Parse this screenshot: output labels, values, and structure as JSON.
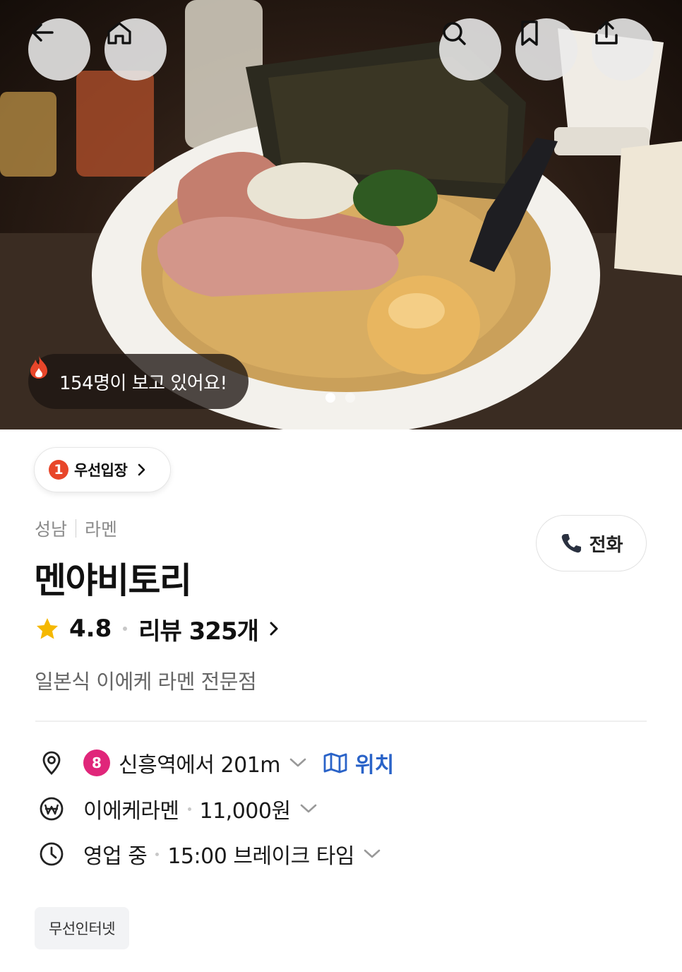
{
  "hero": {
    "viewers_text": "154명이 보고 있어요!",
    "photo_count": 2,
    "active_photo": 1
  },
  "priority": {
    "number": "1",
    "label": "우선입장"
  },
  "place": {
    "region": "성남",
    "category": "라멘",
    "name": "멘야비토리",
    "rating": "4.8",
    "reviews": "리뷰 325개",
    "description": "일본식 이에케 라멘 전문점"
  },
  "call": {
    "label": "전화"
  },
  "info": {
    "subway_line": "8",
    "distance": "신흥역에서 201m",
    "map_label": "위치",
    "menu": "이에케라멘",
    "price": "11,000원",
    "status": "영업 중",
    "hours": "15:00 브레이크 타임"
  },
  "tags": [
    "무선인터넷"
  ],
  "colors": {
    "accent": "#2a63c8",
    "star": "#f5b800",
    "line8": "#e0267a",
    "flame": "#e8462a"
  },
  "icons": [
    "back-arrow-icon",
    "home-icon",
    "search-icon",
    "bookmark-icon",
    "share-icon",
    "flame-icon",
    "chevron-right-icon",
    "phone-icon",
    "star-icon",
    "location-pin-icon",
    "map-icon",
    "won-icon",
    "clock-icon",
    "chevron-down-icon"
  ]
}
